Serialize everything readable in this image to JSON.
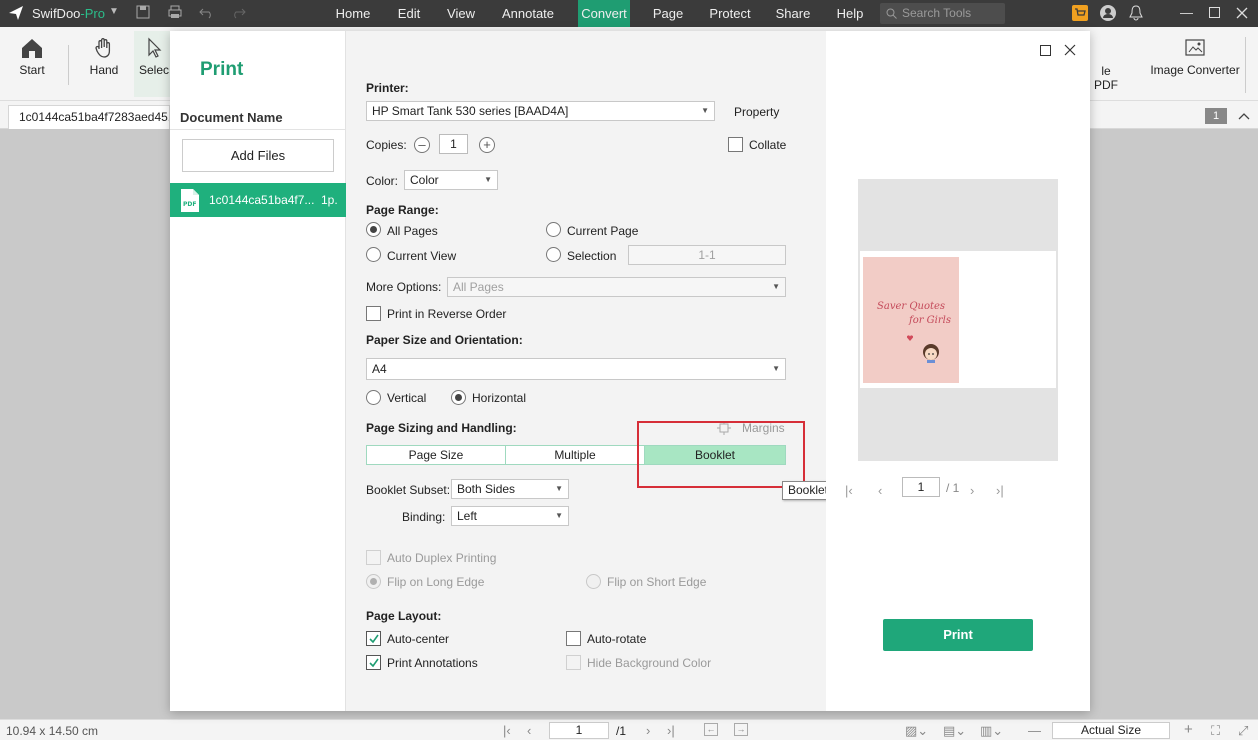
{
  "app": {
    "name_prefix": "SwifDoo",
    "name_suffix": "-Pro",
    "menu": [
      "Home",
      "Edit",
      "View",
      "Annotate",
      "Convert",
      "Page",
      "Protect",
      "Share",
      "Help"
    ],
    "active_menu": "Convert",
    "search_placeholder": "Search Tools"
  },
  "toolbar": {
    "start": "Start",
    "hand": "Hand",
    "select": "Selec",
    "pdf_to": "le PDF",
    "image_converter": "Image Converter"
  },
  "tab": {
    "title": "1c0144ca51ba4f7283aed45...p",
    "page_badge": "1"
  },
  "dialog": {
    "title": "Print",
    "document_name_header": "Document Name",
    "add_files": "Add Files",
    "file": {
      "name": "1c0144ca51ba4f7...",
      "pages": "1p."
    },
    "printer_label": "Printer:",
    "printer_value": "HP Smart Tank 530 series [BAAD4A]",
    "property": "Property",
    "copies_label": "Copies:",
    "copies_value": "1",
    "collate": "Collate",
    "color_label": "Color:",
    "color_value": "Color",
    "page_range_label": "Page Range:",
    "all_pages": "All Pages",
    "current_page": "Current Page",
    "current_view": "Current View",
    "selection": "Selection",
    "selection_value": "1-1",
    "more_options_label": "More Options:",
    "more_options_value": "All Pages",
    "reverse_order": "Print in Reverse Order",
    "paper_label": "Paper Size and Orientation:",
    "paper_value": "A4",
    "vertical": "Vertical",
    "horizontal": "Horizontal",
    "sizing_label": "Page Sizing and Handling:",
    "margins": "Margins",
    "seg_page_size": "Page Size",
    "seg_multiple": "Multiple",
    "seg_booklet": "Booklet",
    "tooltip": "Booklet",
    "booklet_subset_label": "Booklet Subset:",
    "booklet_subset_value": "Both Sides",
    "binding_label": "Binding:",
    "binding_value": "Left",
    "auto_duplex": "Auto Duplex Printing",
    "flip_long": "Flip on Long Edge",
    "flip_short": "Flip on Short Edge",
    "page_layout_label": "Page Layout:",
    "auto_center": "Auto-center",
    "auto_rotate": "Auto-rotate",
    "print_annotations": "Print Annotations",
    "hide_bg": "Hide Background Color",
    "preview_page": "1",
    "preview_total": "/ 1",
    "print_button": "Print",
    "thumb_text_1": "Saver Quotes",
    "thumb_text_2": "for Girls"
  },
  "status": {
    "dimensions": "10.94 x 14.50 cm",
    "page": "1",
    "total": "/1",
    "zoom": "Actual Size"
  },
  "colors": {
    "accent": "#1f9d72",
    "highlight_box": "#d62e38",
    "booklet_active": "#a8e6c3"
  }
}
